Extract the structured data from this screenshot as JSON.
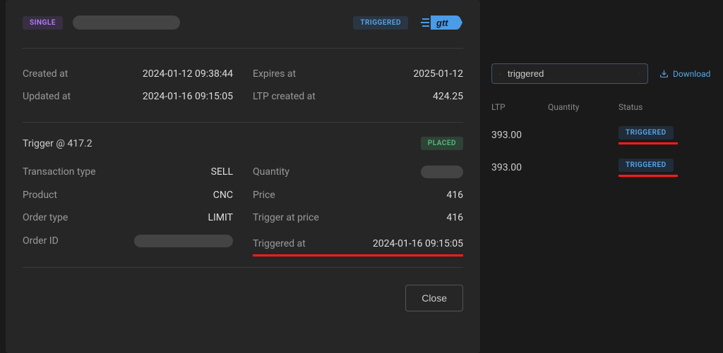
{
  "modal": {
    "type_badge": "SINGLE",
    "status_badge": "TRIGGERED",
    "info": {
      "created_at_label": "Created at",
      "created_at_value": "2024-01-12 09:38:44",
      "updated_at_label": "Updated at",
      "updated_at_value": "2024-01-16 09:15:05",
      "expires_at_label": "Expires at",
      "expires_at_value": "2025-01-12",
      "ltp_created_label": "LTP created at",
      "ltp_created_value": "424.25"
    },
    "trigger": {
      "title": "Trigger @ 417.2",
      "placed_badge": "PLACED",
      "txn_type_label": "Transaction type",
      "txn_type_value": "SELL",
      "product_label": "Product",
      "product_value": "CNC",
      "order_type_label": "Order type",
      "order_type_value": "LIMIT",
      "order_id_label": "Order ID",
      "quantity_label": "Quantity",
      "price_label": "Price",
      "price_value": "416",
      "trigger_price_label": "Trigger at price",
      "trigger_price_value": "416",
      "triggered_at_label": "Triggered at",
      "triggered_at_value": "2024-01-16 09:15:05"
    },
    "close_label": "Close"
  },
  "side": {
    "search_value": "triggered",
    "download_label": "Download",
    "columns": {
      "ltp": "LTP",
      "qty": "Quantity",
      "status": "Status"
    },
    "rows": [
      {
        "ltp": "393.00",
        "status": "TRIGGERED"
      },
      {
        "ltp": "393.00",
        "status": "TRIGGERED"
      }
    ]
  }
}
